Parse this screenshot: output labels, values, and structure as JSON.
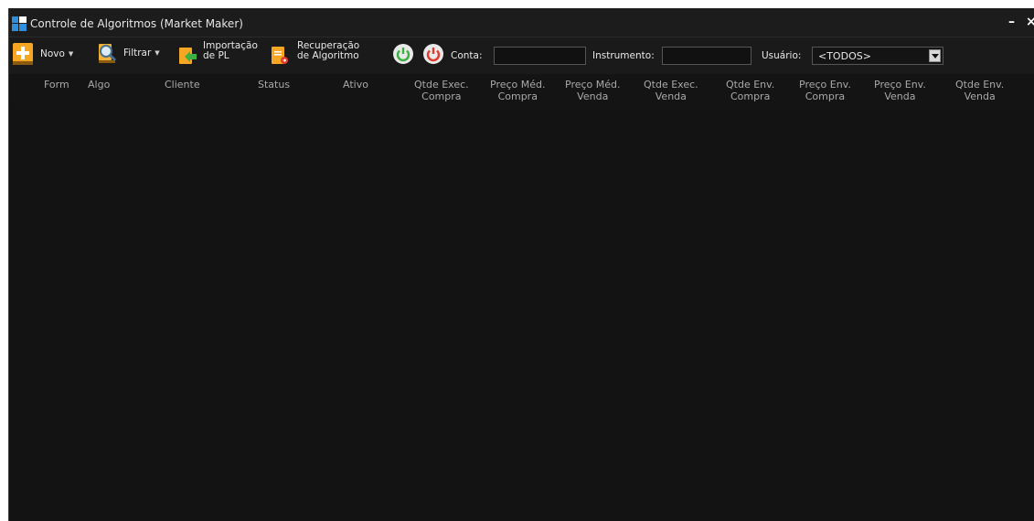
{
  "window": {
    "title": "Controle de Algoritmos (Market Maker)",
    "minimize": "–",
    "close": "×"
  },
  "toolbar": {
    "novo": "Novo",
    "filtrar": "Filtrar",
    "importacao_line1": "Importação",
    "importacao_line2": "de PL",
    "recuperacao_line1": "Recuperação",
    "recuperacao_line2": "de Algoritmo",
    "conta_label": "Conta:",
    "conta_value": "",
    "instrumento_label": "Instrumento:",
    "instrumento_value": "",
    "usuario_label": "Usuário:",
    "usuario_value": "<TODOS>"
  },
  "columns": [
    {
      "line1": "Form",
      "line2": ""
    },
    {
      "line1": "Algo",
      "line2": ""
    },
    {
      "line1": "Cliente",
      "line2": ""
    },
    {
      "line1": "Status",
      "line2": ""
    },
    {
      "line1": "Ativo",
      "line2": ""
    },
    {
      "line1": "Qtde Exec.",
      "line2": "Compra"
    },
    {
      "line1": "Preço Méd.",
      "line2": "Compra"
    },
    {
      "line1": "Preço Méd.",
      "line2": "Venda"
    },
    {
      "line1": "Qtde Exec.",
      "line2": "Venda"
    },
    {
      "line1": "Qtde Env.",
      "line2": "Compra"
    },
    {
      "line1": "Preço Env.",
      "line2": "Compra"
    },
    {
      "line1": "Preço Env.",
      "line2": "Venda"
    },
    {
      "line1": "Qtde Env.",
      "line2": "Venda"
    }
  ],
  "rows": [],
  "colors": {
    "background": "#131313",
    "accent_orange": "#f5a623",
    "start_green": "#3cb043",
    "stop_red": "#e03b2f"
  },
  "icons": [
    "app-grid-icon",
    "add-icon",
    "filter-icon",
    "import-icon",
    "recover-icon",
    "start-icon",
    "stop-icon"
  ]
}
